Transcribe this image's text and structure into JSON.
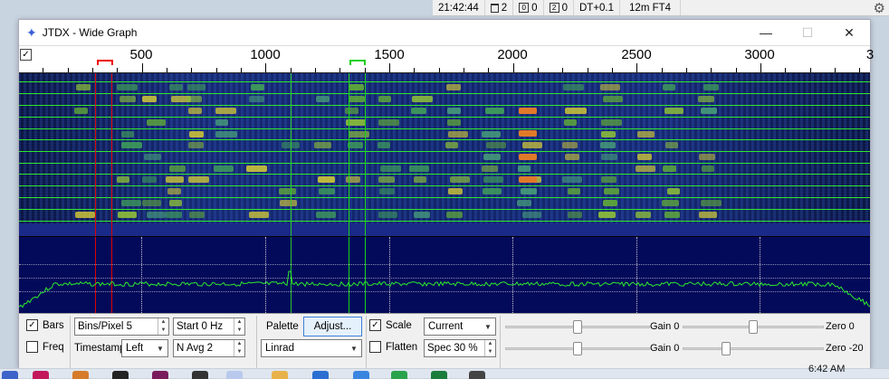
{
  "status": {
    "time": "21:42:44",
    "trash_count": "2",
    "box1_icon": "0",
    "box1_count": "0",
    "box2_icon": "2",
    "box2_count": "0",
    "dt": "DT+0.1",
    "band_mode": "12m FT4"
  },
  "window": {
    "title": "JTDX - Wide Graph",
    "app_icon": "star-icon"
  },
  "scale": {
    "checkbox": "✓",
    "labels": [
      "500",
      "1000",
      "1500",
      "2000",
      "2500",
      "3000"
    ],
    "partial_label": "3"
  },
  "controls": {
    "bars_label": "Bars",
    "bars_checked": true,
    "freq_label": "Freq",
    "freq_checked": false,
    "bins_pixel": "Bins/Pixel  5",
    "start": "Start 0 Hz",
    "timestamp_label": "Timestamp",
    "timestamp_value": "Left",
    "navg": "N Avg 2",
    "palette_label": "Palette",
    "adjust_label": "Adjust...",
    "palette_value": "Linrad",
    "scale_label": "Scale",
    "scale_checked": true,
    "flatten_label": "Flatten",
    "flatten_checked": false,
    "current_value": "Current",
    "spec_value": "Spec 30 %",
    "gain1_label": "Gain 0",
    "zero1_label": "Zero 0",
    "gain2_label": "Gain 0",
    "zero2_label": "Zero -20"
  },
  "taskbar": {
    "clock": "6:42 AM"
  },
  "colors": {
    "rx_marker": "#e00000",
    "tx_marker": "#1bd11b",
    "waterfall_bg": "#0a1136",
    "spectrum_bg": "#030a5a",
    "trace": "#2ee82e"
  }
}
